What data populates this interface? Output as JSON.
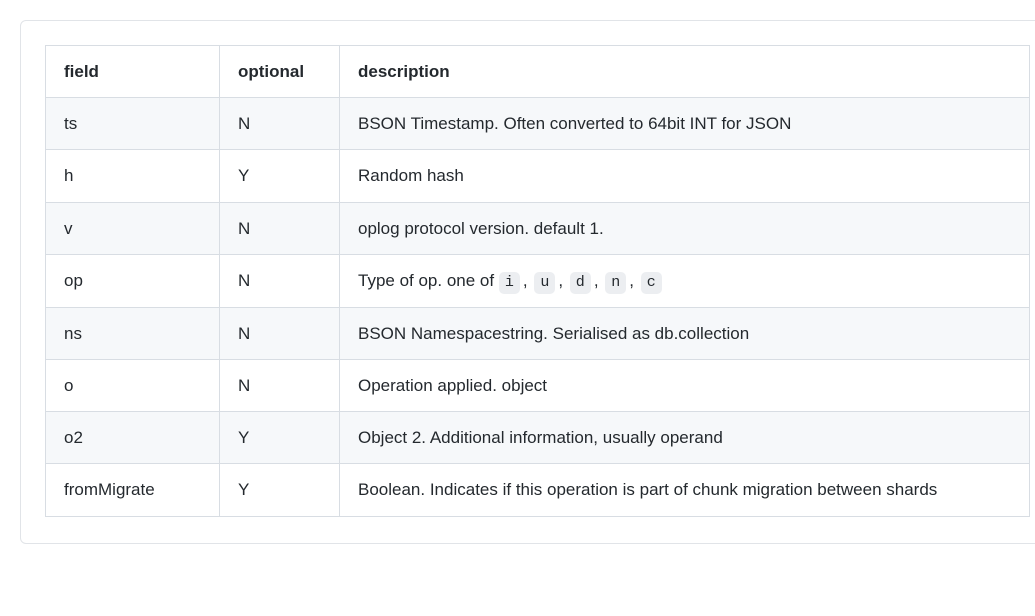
{
  "table": {
    "headers": {
      "field": "field",
      "optional": "optional",
      "description": "description"
    },
    "rows": [
      {
        "field": "ts",
        "optional": "N",
        "description": "BSON Timestamp. Often converted to 64bit INT for JSON"
      },
      {
        "field": "h",
        "optional": "Y",
        "description": "Random hash"
      },
      {
        "field": "v",
        "optional": "N",
        "description": "oplog protocol version. default 1."
      },
      {
        "field": "op",
        "optional": "N",
        "description_prefix": "Type of op. one of ",
        "codes": [
          "i",
          "u",
          "d",
          "n",
          "c"
        ],
        "code_separator": ","
      },
      {
        "field": "ns",
        "optional": "N",
        "description": "BSON Namespacestring. Serialised as db.collection"
      },
      {
        "field": "o",
        "optional": "N",
        "description": "Operation applied. object"
      },
      {
        "field": "o2",
        "optional": "Y",
        "description": "Object 2. Additional information, usually operand"
      },
      {
        "field": "fromMigrate",
        "optional": "Y",
        "description": "Boolean. Indicates if this operation is part of chunk migration between shards"
      }
    ]
  }
}
